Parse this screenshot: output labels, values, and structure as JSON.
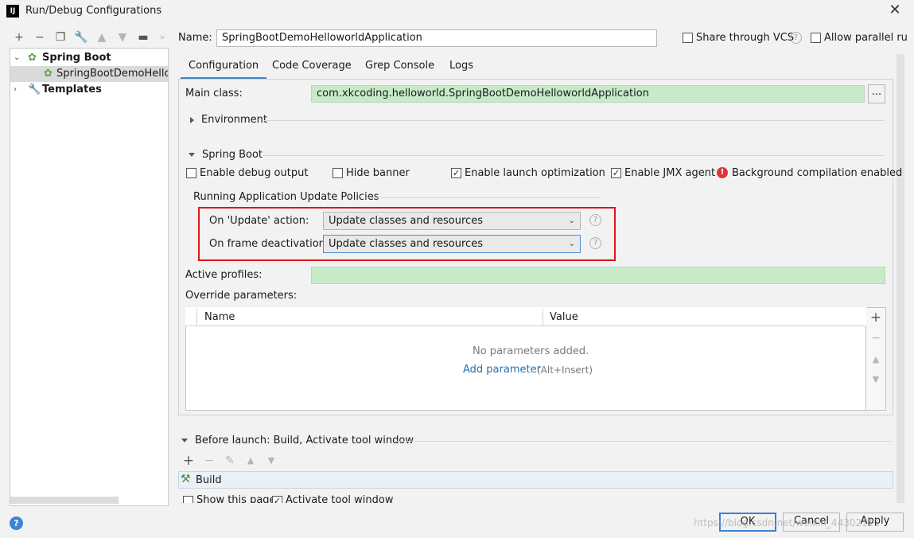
{
  "window": {
    "title": "Run/Debug Configurations",
    "app_icon": "IJ",
    "close_icon": "close-icon"
  },
  "toolbar": {
    "icons": [
      "plus-icon",
      "minus-icon",
      "copy-icon",
      "wrench-icon",
      "arrow-up-icon",
      "arrow-down-icon",
      "folder-icon",
      "more-icon"
    ]
  },
  "tree": {
    "items": [
      {
        "label": "Spring Boot",
        "icon": "spring-boot-icon",
        "expanded": true
      },
      {
        "label": "SpringBootDemoHellow",
        "icon": "spring-boot-icon",
        "selected": true
      },
      {
        "label": "Templates",
        "icon": "wrench-icon",
        "expanded": false
      }
    ]
  },
  "name": {
    "label": "Name:",
    "value": "SpringBootDemoHelloworldApplication"
  },
  "header_options": {
    "share": {
      "label": "Share through VCS",
      "checked": false
    },
    "parallel": {
      "label": "Allow parallel run",
      "checked": false
    }
  },
  "tabs": [
    {
      "label": "Configuration",
      "active": true
    },
    {
      "label": "Code Coverage"
    },
    {
      "label": "Grep Console"
    },
    {
      "label": "Logs"
    }
  ],
  "main_class": {
    "label": "Main class:",
    "value": "com.xkcoding.helloworld.SpringBootDemoHelloworldApplication",
    "browse": "..."
  },
  "environment": {
    "label": "Environment"
  },
  "spring_boot": {
    "label": "Spring Boot",
    "options": {
      "debug": {
        "label": "Enable debug output",
        "checked": false
      },
      "banner": {
        "label": "Hide banner",
        "checked": false
      },
      "launch_opt": {
        "label": "Enable launch optimization",
        "checked": true
      },
      "jmx": {
        "label": "Enable JMX agent",
        "checked": true
      },
      "bg_compile": {
        "label": "Background compilation enabled"
      }
    },
    "policies_title": "Running Application Update Policies",
    "update_action": {
      "label": "On 'Update' action:",
      "value": "Update classes and resources"
    },
    "frame_deactivation": {
      "label": "On frame deactivation:",
      "value": "Update classes and resources"
    }
  },
  "active_profiles": {
    "label": "Active profiles:",
    "value": ""
  },
  "override": {
    "label": "Override parameters:",
    "columns": [
      "Name",
      "Value"
    ],
    "empty_text": "No parameters added.",
    "add_link": "Add parameter",
    "add_hint": "(Alt+Insert)"
  },
  "before_launch": {
    "label": "Before launch: Build, Activate tool window",
    "items": [
      "Build"
    ],
    "show_page": "Show this page",
    "activate": "Activate tool window"
  },
  "buttons": {
    "ok": "OK",
    "cancel": "Cancel",
    "apply": "Apply"
  },
  "watermark": "https://blog.csdn.net/weixin_44302111"
}
